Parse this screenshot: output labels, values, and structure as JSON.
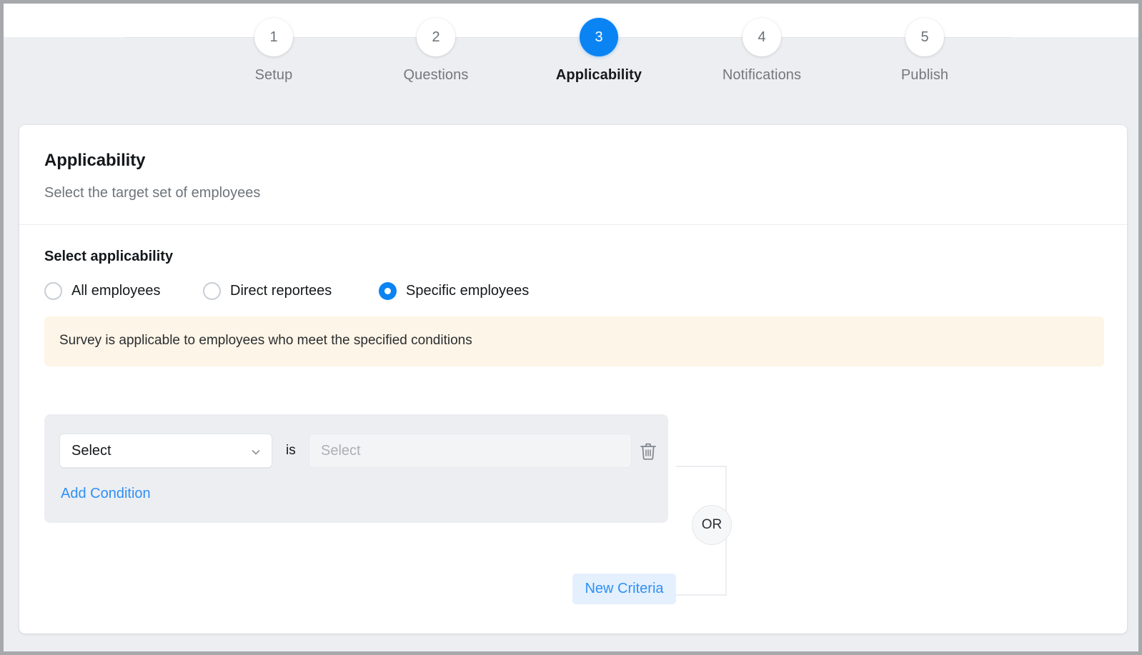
{
  "stepper": {
    "steps": [
      {
        "number": "1",
        "label": "Setup",
        "active": false
      },
      {
        "number": "2",
        "label": "Questions",
        "active": false
      },
      {
        "number": "3",
        "label": "Applicability",
        "active": true
      },
      {
        "number": "4",
        "label": "Notifications",
        "active": false
      },
      {
        "number": "5",
        "label": "Publish",
        "active": false
      }
    ]
  },
  "card": {
    "title": "Applicability",
    "subtitle": "Select the target set of employees",
    "section_title": "Select applicability"
  },
  "applicability": {
    "options": [
      {
        "label": "All employees",
        "selected": false
      },
      {
        "label": "Direct reportees",
        "selected": false
      },
      {
        "label": "Specific employees",
        "selected": true
      }
    ],
    "info_banner": "Survey is applicable to employees who meet the specified conditions"
  },
  "condition": {
    "field_value": "Select",
    "operator_label": "is",
    "value_placeholder": "Select",
    "delete_icon": "trash-icon",
    "chevron_icon": "chevron-down-icon",
    "add_condition_label": "Add Condition"
  },
  "logic": {
    "operator_node": "OR",
    "new_criteria_label": "New Criteria"
  },
  "colors": {
    "accent_blue": "#0b84f3",
    "link_blue": "#2f90f5",
    "banner_bg": "#fdf5e7",
    "panel_bg": "#eceef1",
    "page_bg": "#eceef1",
    "new_criteria_bg": "#e4f0fd"
  }
}
